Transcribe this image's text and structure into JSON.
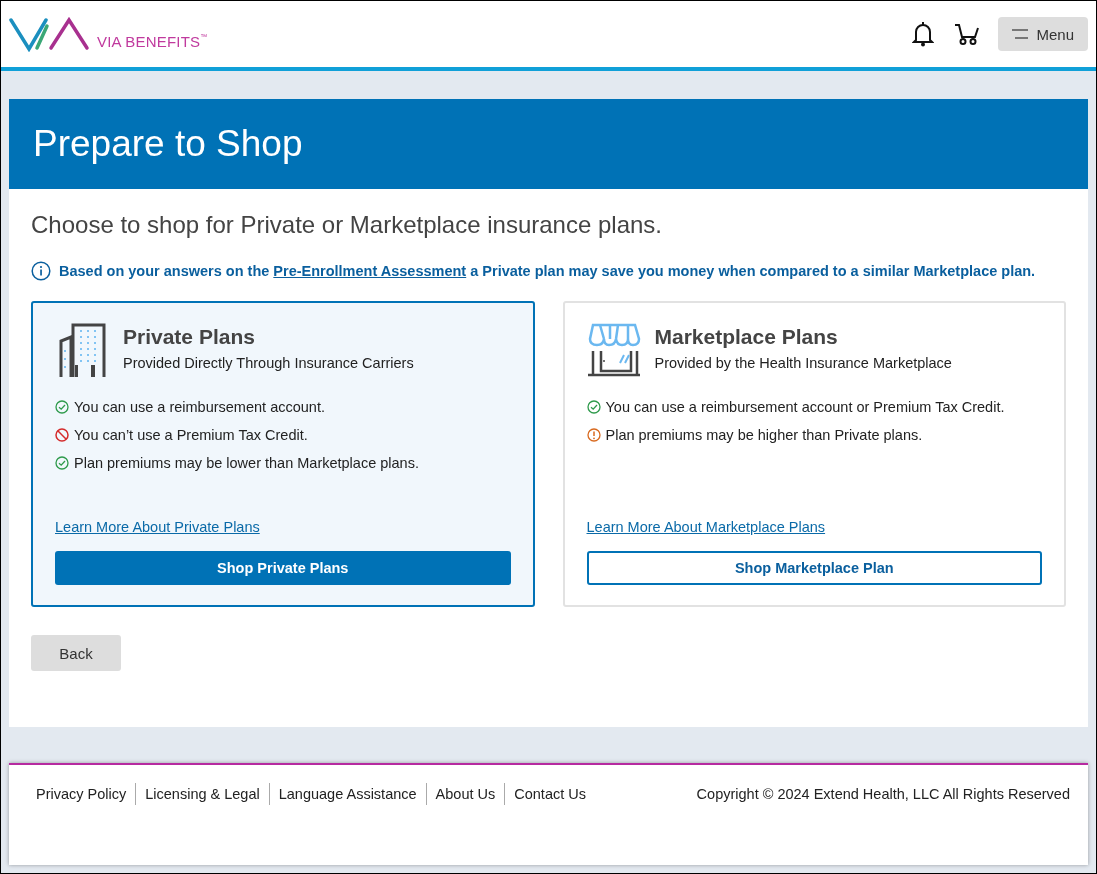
{
  "header": {
    "brand": "VIA BENEFITS",
    "trademark": "™",
    "menu_label": "Menu"
  },
  "page_title": "Prepare to Shop",
  "subtitle": "Choose to shop for Private or Marketplace insurance plans.",
  "info": {
    "before": "Based on your answers on the ",
    "link": "Pre-Enrollment Assessment",
    "after": " a Private plan may save you money when compared to a similar Marketplace plan."
  },
  "plans": [
    {
      "kind": "building",
      "selected": true,
      "title": "Private Plans",
      "subtitle": "Provided Directly Through Insurance Carriers",
      "features": [
        {
          "kind": "check",
          "text": "You can use a reimbursement account."
        },
        {
          "kind": "no",
          "text": "You can’t use a Premium Tax Credit."
        },
        {
          "kind": "check",
          "text": "Plan premiums may be lower than Marketplace plans."
        }
      ],
      "link": "Learn More About Private Plans",
      "button": "Shop Private Plans"
    },
    {
      "kind": "store",
      "selected": false,
      "title": "Marketplace Plans",
      "subtitle": "Provided by the Health Insurance Marketplace",
      "features": [
        {
          "kind": "check",
          "text": "You can use a reimbursement account or Premium Tax Credit."
        },
        {
          "kind": "warn",
          "text": "Plan premiums may be higher than Private plans."
        }
      ],
      "link": "Learn More About Marketplace Plans",
      "button": "Shop Marketplace Plan"
    }
  ],
  "back_button": "Back",
  "footer": {
    "links": [
      "Privacy Policy",
      "Licensing & Legal",
      "Language Assistance",
      "About Us",
      "Contact Us"
    ],
    "copyright": "Copyright © 2024 Extend Health, LLC All Rights Reserved"
  }
}
